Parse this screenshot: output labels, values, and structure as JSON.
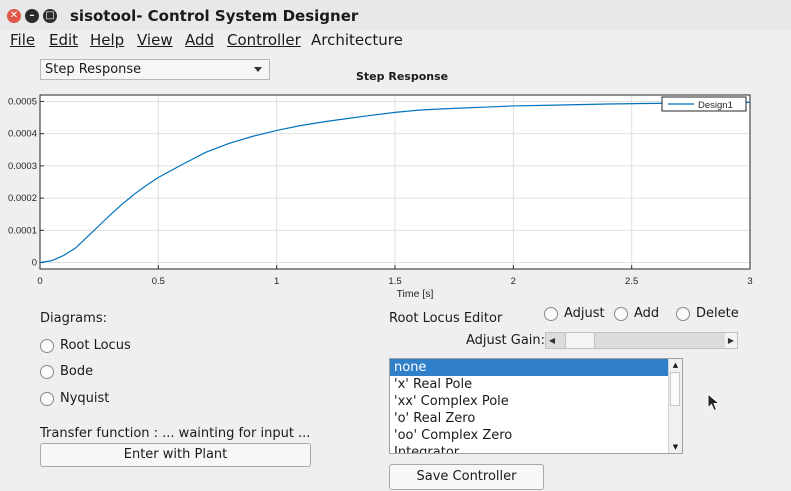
{
  "window": {
    "title": "sisotool- Control System Designer"
  },
  "menu": [
    "File",
    "Edit",
    "Help",
    "View",
    "Add",
    "Controller",
    "Architecture"
  ],
  "plot_selector": {
    "value": "Step Response"
  },
  "chart_data": {
    "type": "line",
    "title": "Step Response",
    "xlabel": "Time [s]",
    "ylabel": "",
    "xlim": [
      0,
      3
    ],
    "ylim": [
      -2e-05,
      0.00052
    ],
    "x_ticks": [
      "0",
      "0.5",
      "1",
      "1.5",
      "2",
      "2.5",
      "3"
    ],
    "y_ticks": [
      "0",
      "0.0001",
      "0.0002",
      "0.0003",
      "0.0004",
      "0.0005"
    ],
    "grid": true,
    "legend": "top-right",
    "series": [
      {
        "name": "Design1",
        "color": "#0072bd",
        "x": [
          0,
          0.05,
          0.1,
          0.15,
          0.2,
          0.25,
          0.3,
          0.35,
          0.4,
          0.45,
          0.5,
          0.6,
          0.7,
          0.8,
          0.9,
          1.0,
          1.1,
          1.2,
          1.3,
          1.4,
          1.5,
          1.6,
          1.7,
          1.8,
          1.9,
          2.0,
          2.2,
          2.4,
          2.6,
          2.8,
          3.0
        ],
        "y": [
          0,
          6e-06,
          2.2e-05,
          4.5e-05,
          8e-05,
          0.000115,
          0.00015,
          0.000183,
          0.000213,
          0.00024,
          0.000264,
          0.000304,
          0.000342,
          0.00037,
          0.000392,
          0.00041,
          0.000425,
          0.000437,
          0.000447,
          0.000457,
          0.000466,
          0.000473,
          0.000477,
          0.00048,
          0.000483,
          0.000486,
          0.000489,
          0.000492,
          0.000494,
          0.000496,
          0.000497
        ]
      }
    ]
  },
  "diagrams": {
    "label": "Diagrams:",
    "options": [
      "Root Locus",
      "Bode",
      "Nyquist"
    ]
  },
  "transfer_function": {
    "text": "Transfer function : ... wainting for input ..."
  },
  "plant_button": {
    "label": "Enter with Plant"
  },
  "root_locus_editor": {
    "label": "Root Locus Editor",
    "modes": [
      "Adjust",
      "Add",
      "Delete"
    ],
    "gain_label": "Adjust Gain:",
    "gain_slider_fraction": 0.05
  },
  "element_list": {
    "items": [
      "none",
      "'x' Real Pole",
      "'xx' Complex Pole",
      "'o' Real Zero",
      "'oo' Complex Zero",
      "Integrator"
    ],
    "selected": "none"
  },
  "save_button": {
    "label": "Save Controller"
  }
}
